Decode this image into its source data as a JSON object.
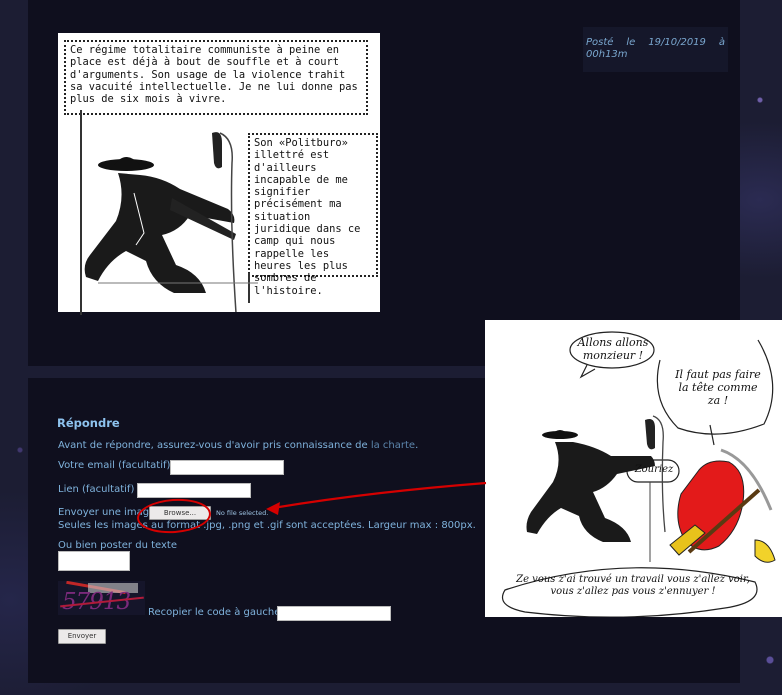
{
  "post": {
    "bubble1": "Ce régime totalitaire communiste à peine en place est déjà à bout de souffle et à court d'arguments. Son usage de la violence trahit sa vacuité intellectuelle. Je ne lui donne pas plus de six mois à vivre.",
    "bubble2": "Son «Politburo» illettré est d'ailleurs incapable de me signifier précisément ma situation juridique dans ce camp qui nous rappelle les heures les plus sombres de l'histoire.",
    "date_line1": "Posté le 19/10/2019 à",
    "date_line2": "00h13m"
  },
  "reply": {
    "title": "Répondre",
    "intro": "Avant de répondre, assurez-vous d'avoir pris connaissance de ",
    "charte_link": "la charte",
    "intro_end": ".",
    "email_label": "Votre email (facultatif) :",
    "link_label": "Lien (facultatif) :",
    "image_label": "Envoyer une image",
    "browse_label": "Browse...",
    "no_file": "No file selected.",
    "image_note": "Seules les images au format .jpg, .png et .gif sont acceptées. Largeur max : 800px.",
    "text_option": "Ou bien poster du texte",
    "captcha_code": "57913",
    "captcha_label": "Recopier le code à gauche :",
    "submit_label": "Envoyer"
  },
  "comic2": {
    "bubble1": "Allons allons monzieur !",
    "bubble2": "Il faut pas faire la tête comme za !",
    "bubble3": "Zouriez",
    "bubble4": "Ze vous z'ai trouvé un travail vous z'allez voir, vous z'allez pas vous z'ennuyer !"
  },
  "colors": {
    "annotation": "#d50000",
    "link": "#7fb2dc",
    "panel": "#0f0f1e"
  }
}
